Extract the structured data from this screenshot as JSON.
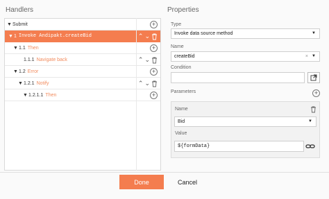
{
  "handlers": {
    "title": "Handlers",
    "rows": [
      {
        "caret": "▼",
        "num": "",
        "label": "Submit"
      },
      {
        "caret": "▼",
        "num": "1",
        "label": "Invoke Andipakt.createBid"
      },
      {
        "caret": "▼",
        "num": "1.1",
        "label": "Then"
      },
      {
        "caret": "",
        "num": "1.1.1",
        "label": "Navigate back"
      },
      {
        "caret": "▼",
        "num": "1.2",
        "label": "Error"
      },
      {
        "caret": "▼",
        "num": "1.2.1",
        "label": "Notify"
      },
      {
        "caret": "▼",
        "num": "1.2.1.1",
        "label": "Then"
      }
    ]
  },
  "properties": {
    "title": "Properties",
    "type_label": "Type",
    "type_value": "Invoke data source method",
    "name_label": "Name",
    "name_value": "createBid",
    "condition_label": "Condition",
    "condition_value": "",
    "parameters_label": "Parameters",
    "param": {
      "name_label": "Name",
      "name_value": "Bid",
      "value_label": "Value",
      "value_value": "${formData}"
    }
  },
  "footer": {
    "done_label": "Done",
    "cancel_label": "Cancel"
  },
  "colors": {
    "accent": "#f47d4f",
    "secondary_label": "#f28b5d"
  }
}
